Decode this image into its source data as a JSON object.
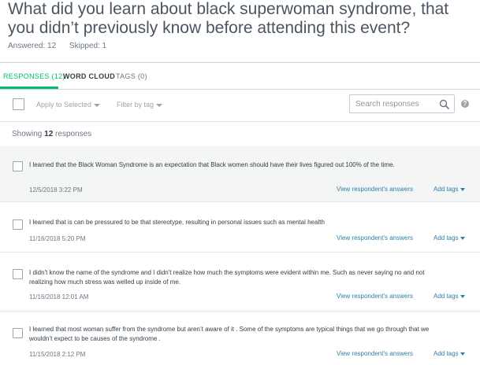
{
  "question": {
    "title": "What did you learn about black superwoman syndrome, that you didn’t previously know before attending this event?",
    "answered": "Answered: 12",
    "skipped": "Skipped: 1"
  },
  "tabs": [
    {
      "label": "RESPONSES (12)",
      "active": true
    },
    {
      "label": "WORD CLOUD",
      "active": false
    },
    {
      "label": "TAGS (0)",
      "active": false
    }
  ],
  "toolbar": {
    "apply_label": "Apply to Selected",
    "filter_label": "Filter by tag",
    "search_placeholder": "Search responses",
    "help_icon": "?"
  },
  "showing": {
    "prefix": "Showing",
    "count": "12",
    "suffix": "responses"
  },
  "responses": [
    {
      "text": "I learned that the Black Woman Syndrome is an expectation that Black women should have their lives figured out 100% of the time.",
      "date": "12/5/2018 3:22 PM",
      "view_label": "View respondent's answers",
      "tags_label": "Add tags"
    },
    {
      "text": "I learned that is can be pressured to be that stereotype, resulting in personal issues such as mental health",
      "date": "11/16/2018 5:20 PM",
      "view_label": "View respondent's answers",
      "tags_label": "Add tags"
    },
    {
      "text": "I didn't know the name of the syndrome and I didn't realize how much the symptoms were evident within me. Such as never saying no and not realizing how much stress was welled up inside of me.",
      "date": "11/16/2018 12:01 AM",
      "view_label": "View respondent's answers",
      "tags_label": "Add tags"
    },
    {
      "text": "I learned that most woman suffer from the syndrome but aren’t aware of it . Some of the symptoms are typical things that we go through that we wouldn’t expect to be causes of the syndrome .",
      "date": "11/15/2018 2:12 PM",
      "view_label": "View respondent's answers",
      "tags_label": "Add tags"
    }
  ],
  "colors": {
    "accent": "#00bf6f",
    "link": "#2d7fa8",
    "highlight_row": "#f4f5f5"
  }
}
